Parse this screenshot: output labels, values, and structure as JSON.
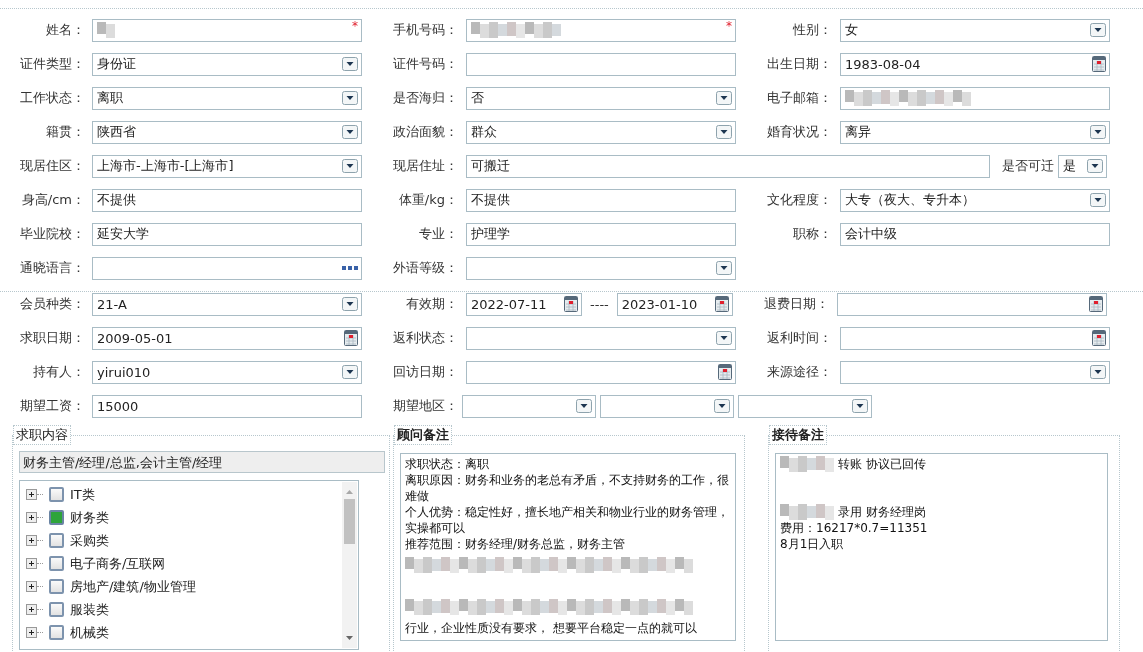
{
  "personal_info": {
    "rows": [
      {
        "fields": [
          {
            "label": "姓名：",
            "kind": "text",
            "redacted": true,
            "mark": "*"
          },
          {
            "label": "手机号码：",
            "kind": "text",
            "redacted": true,
            "mark": "*"
          },
          {
            "label": "性别：",
            "kind": "select",
            "value": "女"
          }
        ]
      },
      {
        "fields": [
          {
            "label": "证件类型：",
            "kind": "select",
            "value": "身份证"
          },
          {
            "label": "证件号码：",
            "kind": "text"
          },
          {
            "label": "出生日期：",
            "kind": "date",
            "value": "1983-08-04"
          }
        ]
      },
      {
        "fields": [
          {
            "label": "工作状态：",
            "kind": "select",
            "value": "离职"
          },
          {
            "label": "是否海归：",
            "kind": "select",
            "value": "否"
          },
          {
            "label": "电子邮箱：",
            "kind": "text",
            "redacted": true
          }
        ]
      },
      {
        "fields": [
          {
            "label": "籍贯：",
            "kind": "select",
            "value": "陕西省"
          },
          {
            "label": "政治面貌：",
            "kind": "select",
            "value": "群众"
          },
          {
            "label": "婚育状况：",
            "kind": "select",
            "value": "离异"
          }
        ]
      },
      {
        "fields": [
          {
            "label": "现居住区：",
            "kind": "select",
            "value": "上海市-上海市-[上海市]"
          },
          {
            "label": "现居住址：",
            "kind": "text",
            "value": "可搬迁",
            "wide": true
          },
          {
            "label": "是否可迁",
            "kind": "select",
            "value": "是",
            "compact": true
          }
        ]
      },
      {
        "fields": [
          {
            "label": "身高/cm：",
            "kind": "text",
            "value": "不提供"
          },
          {
            "label": "体重/kg：",
            "kind": "text",
            "value": "不提供"
          },
          {
            "label": "文化程度：",
            "kind": "select",
            "value": "大专（夜大、专升本）"
          }
        ]
      },
      {
        "fields": [
          {
            "label": "毕业院校：",
            "kind": "text",
            "value": "延安大学"
          },
          {
            "label": "专业：",
            "kind": "text",
            "value": "护理学"
          },
          {
            "label": "职称：",
            "kind": "text",
            "value": "会计中级"
          }
        ]
      },
      {
        "fields": [
          {
            "label": "通晓语言：",
            "kind": "picker"
          },
          {
            "label": "外语等级：",
            "kind": "select"
          }
        ]
      }
    ]
  },
  "membership": {
    "rows": [
      {
        "fields": [
          {
            "label": "会员种类：",
            "kind": "select",
            "value": "21-A"
          },
          {
            "label": "有效期：",
            "kind": "date-range",
            "values": [
              "2022-07-11",
              "2023-01-10"
            ],
            "separator": "----"
          },
          {
            "label": "退费日期：",
            "kind": "date"
          }
        ]
      },
      {
        "fields": [
          {
            "label": "求职日期：",
            "kind": "date",
            "value": "2009-05-01"
          },
          {
            "label": "返利状态：",
            "kind": "select"
          },
          {
            "label": "返利时间：",
            "kind": "date"
          }
        ]
      },
      {
        "fields": [
          {
            "label": "持有人：",
            "kind": "select",
            "value": "yirui010"
          },
          {
            "label": "回访日期：",
            "kind": "date"
          },
          {
            "label": "来源途径：",
            "kind": "select"
          }
        ]
      },
      {
        "fields": [
          {
            "label": "期望工资：",
            "kind": "text",
            "value": "15000"
          },
          {
            "label": "期望地区：",
            "kind": "multi-select",
            "dropdowns": [
              {
                "kind": "select"
              },
              {
                "kind": "select"
              },
              {
                "kind": "select"
              }
            ]
          }
        ]
      }
    ]
  },
  "job_content": {
    "title": "求职内容",
    "summary": "财务主管/经理/总监,会计主管/经理",
    "tree": [
      {
        "label": "IT类",
        "checked": false,
        "expanded": false
      },
      {
        "label": "财务类",
        "checked": true,
        "expanded": false
      },
      {
        "label": "采购类",
        "checked": false,
        "expanded": false
      },
      {
        "label": "电子商务/互联网",
        "checked": false,
        "expanded": false
      },
      {
        "label": "房地产/建筑/物业管理",
        "checked": false,
        "expanded": false
      },
      {
        "label": "服装类",
        "checked": false,
        "expanded": false
      },
      {
        "label": "机械类",
        "checked": false,
        "expanded": false
      }
    ]
  },
  "consultant_notes": {
    "title": "顾问备注",
    "lines": [
      {
        "kind": "text",
        "text": "求职状态：离职"
      },
      {
        "kind": "text",
        "text": "离职原因：财务和业务的老总有矛盾，不支持财务的工作，很难做"
      },
      {
        "kind": "text",
        "text": "个人优势：稳定性好，擅长地产相关和物业行业的财务管理，实操都可以"
      },
      {
        "kind": "text",
        "text": "推荐范围：财务经理/财务总监，财务主管"
      },
      {
        "kind": "redacted"
      },
      {
        "kind": "blank"
      },
      {
        "kind": "redacted"
      },
      {
        "kind": "text",
        "text": "行业，企业性质没有要求， 想要平台稳定一点的就可以"
      }
    ]
  },
  "reception_notes": {
    "title": "接待备注",
    "lines": [
      {
        "kind": "text",
        "text": "转账 协议已回传",
        "prefix_redacted": true
      },
      {
        "kind": "blank"
      },
      {
        "kind": "blank"
      },
      {
        "kind": "text",
        "text": "录用 财务经理岗",
        "prefix_redacted": true
      },
      {
        "kind": "text",
        "text": "费用：16217*0.7=11351"
      },
      {
        "kind": "text",
        "text": "8月1日入职"
      }
    ]
  }
}
